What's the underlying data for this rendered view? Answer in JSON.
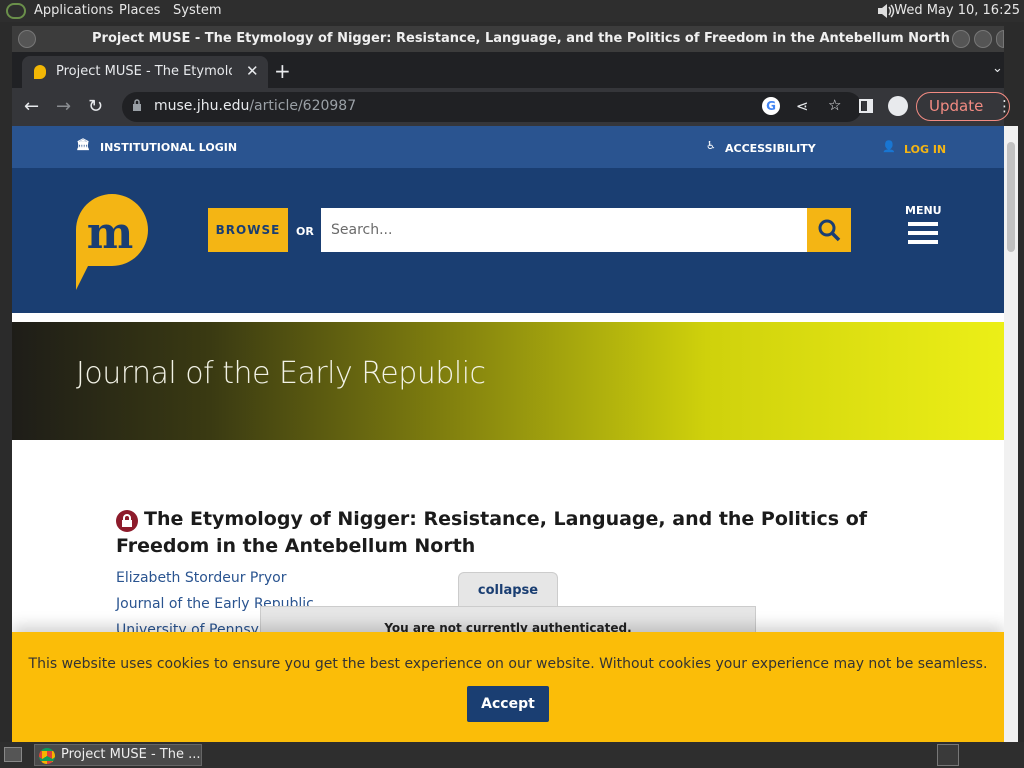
{
  "os_panel": {
    "menus": [
      "Applications",
      "Places",
      "System"
    ],
    "clock": "Wed May 10, 16:25"
  },
  "window": {
    "title": "Project MUSE - The Etymology of Nigger: Resistance, Language, and the Politics of Freedom in the Antebellum North - Google Chrome"
  },
  "browser": {
    "tab_title": "Project MUSE - The Etymolog",
    "url_host": "muse.jhu.edu",
    "url_path": "/article/620987",
    "update_label": "Update"
  },
  "site": {
    "util": {
      "institutional_login": "INSTITUTIONAL LOGIN",
      "accessibility": "ACCESSIBILITY",
      "login": "LOG IN"
    },
    "browse_label": "BROWSE",
    "or_label": "OR",
    "search_placeholder": "Search...",
    "menu_label": "MENU",
    "journal_title": "Journal of the Early Republic",
    "article": {
      "title": "The Etymology of Nigger: Resistance, Language, and the Politics of Freedom in the Antebellum North",
      "author": "Elizabeth Stordeur Pryor",
      "journal": "Journal of the Early Republic",
      "publisher": "University of Pennsylvania Press"
    },
    "auth": {
      "collapse_label": "collapse",
      "message": "You are not currently authenticated."
    },
    "cookie": {
      "message": "This website uses cookies to ensure you get the best experience on our website. Without cookies your experience may not be seamless.",
      "accept_label": "Accept"
    },
    "colors": {
      "primary": "#1a3e72",
      "accent": "#f4b514",
      "util_bar": "#2a5490"
    }
  },
  "taskbar": {
    "task_label": "Project MUSE - The ..."
  }
}
